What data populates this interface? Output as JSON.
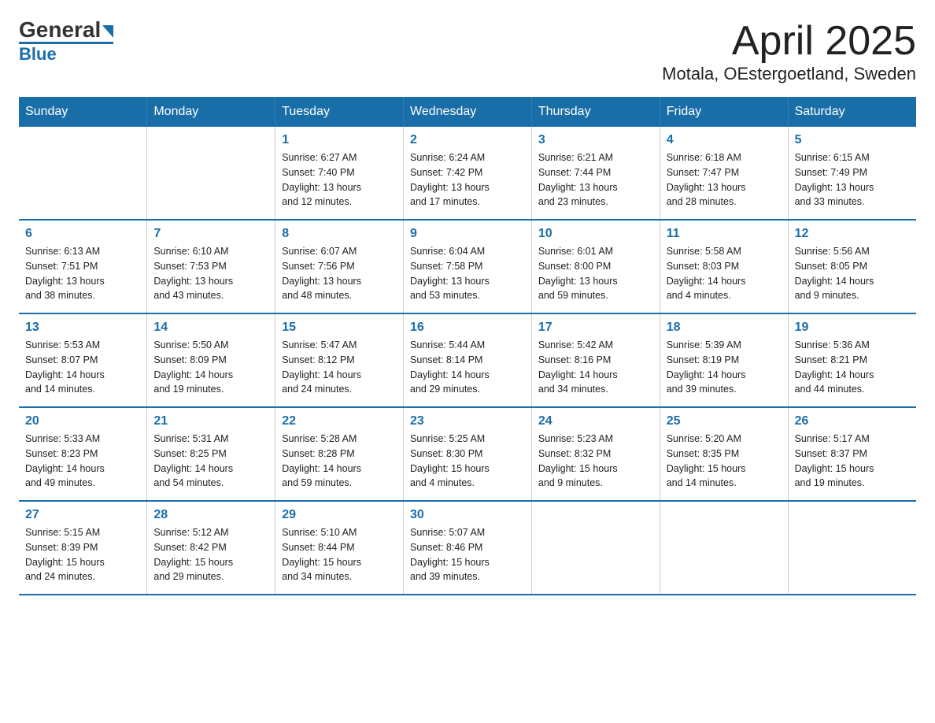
{
  "header": {
    "logo_general": "General",
    "logo_blue": "Blue",
    "title": "April 2025",
    "subtitle": "Motala, OEstergoetland, Sweden"
  },
  "weekdays": [
    "Sunday",
    "Monday",
    "Tuesday",
    "Wednesday",
    "Thursday",
    "Friday",
    "Saturday"
  ],
  "weeks": [
    [
      {
        "day": "",
        "info": ""
      },
      {
        "day": "",
        "info": ""
      },
      {
        "day": "1",
        "info": "Sunrise: 6:27 AM\nSunset: 7:40 PM\nDaylight: 13 hours\nand 12 minutes."
      },
      {
        "day": "2",
        "info": "Sunrise: 6:24 AM\nSunset: 7:42 PM\nDaylight: 13 hours\nand 17 minutes."
      },
      {
        "day": "3",
        "info": "Sunrise: 6:21 AM\nSunset: 7:44 PM\nDaylight: 13 hours\nand 23 minutes."
      },
      {
        "day": "4",
        "info": "Sunrise: 6:18 AM\nSunset: 7:47 PM\nDaylight: 13 hours\nand 28 minutes."
      },
      {
        "day": "5",
        "info": "Sunrise: 6:15 AM\nSunset: 7:49 PM\nDaylight: 13 hours\nand 33 minutes."
      }
    ],
    [
      {
        "day": "6",
        "info": "Sunrise: 6:13 AM\nSunset: 7:51 PM\nDaylight: 13 hours\nand 38 minutes."
      },
      {
        "day": "7",
        "info": "Sunrise: 6:10 AM\nSunset: 7:53 PM\nDaylight: 13 hours\nand 43 minutes."
      },
      {
        "day": "8",
        "info": "Sunrise: 6:07 AM\nSunset: 7:56 PM\nDaylight: 13 hours\nand 48 minutes."
      },
      {
        "day": "9",
        "info": "Sunrise: 6:04 AM\nSunset: 7:58 PM\nDaylight: 13 hours\nand 53 minutes."
      },
      {
        "day": "10",
        "info": "Sunrise: 6:01 AM\nSunset: 8:00 PM\nDaylight: 13 hours\nand 59 minutes."
      },
      {
        "day": "11",
        "info": "Sunrise: 5:58 AM\nSunset: 8:03 PM\nDaylight: 14 hours\nand 4 minutes."
      },
      {
        "day": "12",
        "info": "Sunrise: 5:56 AM\nSunset: 8:05 PM\nDaylight: 14 hours\nand 9 minutes."
      }
    ],
    [
      {
        "day": "13",
        "info": "Sunrise: 5:53 AM\nSunset: 8:07 PM\nDaylight: 14 hours\nand 14 minutes."
      },
      {
        "day": "14",
        "info": "Sunrise: 5:50 AM\nSunset: 8:09 PM\nDaylight: 14 hours\nand 19 minutes."
      },
      {
        "day": "15",
        "info": "Sunrise: 5:47 AM\nSunset: 8:12 PM\nDaylight: 14 hours\nand 24 minutes."
      },
      {
        "day": "16",
        "info": "Sunrise: 5:44 AM\nSunset: 8:14 PM\nDaylight: 14 hours\nand 29 minutes."
      },
      {
        "day": "17",
        "info": "Sunrise: 5:42 AM\nSunset: 8:16 PM\nDaylight: 14 hours\nand 34 minutes."
      },
      {
        "day": "18",
        "info": "Sunrise: 5:39 AM\nSunset: 8:19 PM\nDaylight: 14 hours\nand 39 minutes."
      },
      {
        "day": "19",
        "info": "Sunrise: 5:36 AM\nSunset: 8:21 PM\nDaylight: 14 hours\nand 44 minutes."
      }
    ],
    [
      {
        "day": "20",
        "info": "Sunrise: 5:33 AM\nSunset: 8:23 PM\nDaylight: 14 hours\nand 49 minutes."
      },
      {
        "day": "21",
        "info": "Sunrise: 5:31 AM\nSunset: 8:25 PM\nDaylight: 14 hours\nand 54 minutes."
      },
      {
        "day": "22",
        "info": "Sunrise: 5:28 AM\nSunset: 8:28 PM\nDaylight: 14 hours\nand 59 minutes."
      },
      {
        "day": "23",
        "info": "Sunrise: 5:25 AM\nSunset: 8:30 PM\nDaylight: 15 hours\nand 4 minutes."
      },
      {
        "day": "24",
        "info": "Sunrise: 5:23 AM\nSunset: 8:32 PM\nDaylight: 15 hours\nand 9 minutes."
      },
      {
        "day": "25",
        "info": "Sunrise: 5:20 AM\nSunset: 8:35 PM\nDaylight: 15 hours\nand 14 minutes."
      },
      {
        "day": "26",
        "info": "Sunrise: 5:17 AM\nSunset: 8:37 PM\nDaylight: 15 hours\nand 19 minutes."
      }
    ],
    [
      {
        "day": "27",
        "info": "Sunrise: 5:15 AM\nSunset: 8:39 PM\nDaylight: 15 hours\nand 24 minutes."
      },
      {
        "day": "28",
        "info": "Sunrise: 5:12 AM\nSunset: 8:42 PM\nDaylight: 15 hours\nand 29 minutes."
      },
      {
        "day": "29",
        "info": "Sunrise: 5:10 AM\nSunset: 8:44 PM\nDaylight: 15 hours\nand 34 minutes."
      },
      {
        "day": "30",
        "info": "Sunrise: 5:07 AM\nSunset: 8:46 PM\nDaylight: 15 hours\nand 39 minutes."
      },
      {
        "day": "",
        "info": ""
      },
      {
        "day": "",
        "info": ""
      },
      {
        "day": "",
        "info": ""
      }
    ]
  ]
}
